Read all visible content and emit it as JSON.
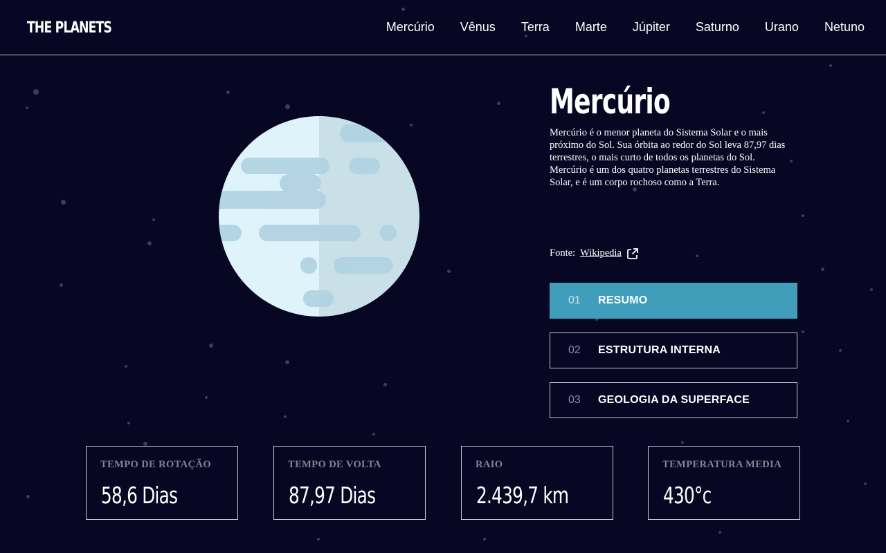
{
  "header": {
    "logo": "THE PLANETS",
    "nav": [
      "Mercúrio",
      "Vênus",
      "Terra",
      "Marte",
      "Júpiter",
      "Saturno",
      "Urano",
      "Netuno"
    ]
  },
  "planet": {
    "name": "Mercúrio",
    "description": "Mercúrio é o menor planeta do Sistema Solar e o mais próximo do Sol. Sua órbita ao redor do Sol leva 87,97 dias terrestres, o mais curto de todos os planetas do Sol. Mercúrio é um dos quatro planetas terrestres do Sistema Solar, e é um corpo rochoso como a Terra.",
    "source_label": "Fonte:",
    "source_link": "Wikipedia"
  },
  "tabs": [
    {
      "num": "01",
      "label": "RESUMO",
      "active": true
    },
    {
      "num": "02",
      "label": "ESTRUTURA INTERNA",
      "active": false
    },
    {
      "num": "03",
      "label": "GEOLOGIA DA SUPERFACE",
      "active": false
    }
  ],
  "stats": [
    {
      "label": "TEMPO DE ROTAÇÃO",
      "value": "58,6 Dias"
    },
    {
      "label": "TEMPO DE VOLTA",
      "value": "87,97 Dias"
    },
    {
      "label": "RAIO",
      "value": "2.439,7 km"
    },
    {
      "label": "TEMPERATURA MEDIA",
      "value": "430°c"
    }
  ],
  "colors": {
    "background": "#070724",
    "accent": "#419ebb",
    "border": "#c9c9d3",
    "muted": "#838391",
    "planet_light": "#dff3fa",
    "planet_shade": "#c9e0e8",
    "planet_marks": "#b2d3e2"
  },
  "icons": {
    "source_link": "external-link-icon"
  }
}
